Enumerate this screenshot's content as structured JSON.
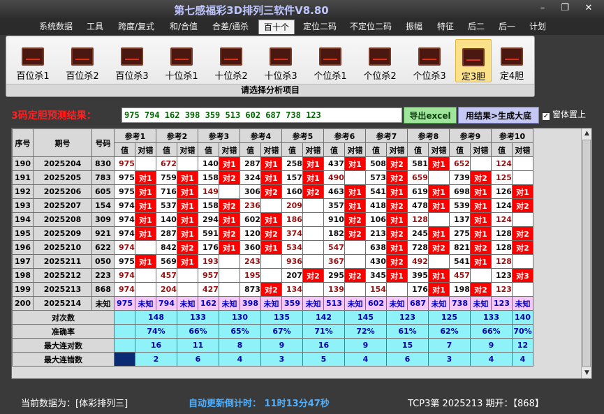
{
  "app": {
    "title": "第七感福彩3D排列三软件V8.80"
  },
  "window_buttons": [
    "–",
    "❐",
    "✕"
  ],
  "menu": [
    "系统数据",
    "工具",
    "跨度/复式",
    "和/合值",
    "合差/通杀",
    "百十个",
    "定位二码",
    "不定位二码",
    "振幅",
    "特征",
    "后二",
    "后一",
    "计划"
  ],
  "menu_active": "百十个",
  "ribbon": {
    "buttons": [
      "百位杀1",
      "百位杀2",
      "百位杀3",
      "十位杀1",
      "十位杀2",
      "十位杀3",
      "个位杀1",
      "个位杀2",
      "个位杀3",
      "定3胆",
      "定4胆"
    ],
    "selected": "定3胆",
    "group_label": "请选择分析项目"
  },
  "result": {
    "label": "3码定胆预测结果：",
    "value": "975  794  162  398  359  513  602  687  738  123",
    "export_button": "导出excel",
    "big_button": "用结果>生成大底",
    "topmost_label": "窗体置上",
    "topmost_checked": true
  },
  "table": {
    "col_seq": "序号",
    "col_period": "期号",
    "col_number": "号码",
    "ref_headers": [
      "参考1",
      "参考2",
      "参考3",
      "参考4",
      "参考5",
      "参考6",
      "参考7",
      "参考8",
      "参考9",
      "参考10"
    ],
    "sub_value": "值",
    "sub_check": "对错",
    "rows": [
      {
        "seq": "190",
        "period": "2025204",
        "number": "830",
        "cells": [
          [
            "975",
            "",
            1
          ],
          [
            "672",
            "",
            1
          ],
          [
            "140",
            "对1",
            0
          ],
          [
            "287",
            "对1",
            0
          ],
          [
            "258",
            "对1",
            0
          ],
          [
            "437",
            "对1",
            0
          ],
          [
            "508",
            "对2",
            0
          ],
          [
            "581",
            "对1",
            0
          ],
          [
            "652",
            "",
            1
          ],
          [
            "124",
            "",
            1
          ]
        ]
      },
      {
        "seq": "191",
        "period": "2025205",
        "number": "783",
        "cells": [
          [
            "975",
            "对1",
            0
          ],
          [
            "759",
            "对1",
            0
          ],
          [
            "158",
            "对2",
            0
          ],
          [
            "324",
            "对1",
            0
          ],
          [
            "157",
            "对1",
            0
          ],
          [
            "490",
            "",
            1
          ],
          [
            "573",
            "对2",
            0
          ],
          [
            "659",
            "",
            1
          ],
          [
            "739",
            "对2",
            0
          ],
          [
            "125",
            "",
            1
          ]
        ]
      },
      {
        "seq": "192",
        "period": "2025206",
        "number": "605",
        "cells": [
          [
            "975",
            "对1",
            0
          ],
          [
            "716",
            "对1",
            0
          ],
          [
            "149",
            "",
            1
          ],
          [
            "306",
            "对2",
            0
          ],
          [
            "160",
            "对2",
            0
          ],
          [
            "463",
            "对1",
            0
          ],
          [
            "541",
            "对1",
            0
          ],
          [
            "619",
            "对1",
            0
          ],
          [
            "698",
            "对1",
            0
          ],
          [
            "126",
            "对1",
            0
          ]
        ]
      },
      {
        "seq": "193",
        "period": "2025207",
        "number": "154",
        "cells": [
          [
            "974",
            "对1",
            0
          ],
          [
            "537",
            "对1",
            0
          ],
          [
            "158",
            "对2",
            0
          ],
          [
            "236",
            "",
            1
          ],
          [
            "209",
            "",
            1
          ],
          [
            "357",
            "对1",
            0
          ],
          [
            "418",
            "对2",
            0
          ],
          [
            "478",
            "对1",
            0
          ],
          [
            "539",
            "对1",
            0
          ],
          [
            "124",
            "对2",
            0
          ]
        ]
      },
      {
        "seq": "194",
        "period": "2025208",
        "number": "309",
        "cells": [
          [
            "974",
            "对1",
            0
          ],
          [
            "140",
            "对1",
            0
          ],
          [
            "294",
            "对1",
            0
          ],
          [
            "602",
            "对1",
            0
          ],
          [
            "186",
            "",
            1
          ],
          [
            "910",
            "对2",
            0
          ],
          [
            "106",
            "对1",
            0
          ],
          [
            "128",
            "",
            1
          ],
          [
            "137",
            "对1",
            0
          ],
          [
            "124",
            "",
            1
          ]
        ]
      },
      {
        "seq": "195",
        "period": "2025209",
        "number": "921",
        "cells": [
          [
            "974",
            "对1",
            0
          ],
          [
            "287",
            "对1",
            0
          ],
          [
            "591",
            "对2",
            0
          ],
          [
            "120",
            "对2",
            0
          ],
          [
            "374",
            "",
            1
          ],
          [
            "182",
            "对2",
            0
          ],
          [
            "213",
            "对2",
            0
          ],
          [
            "245",
            "对1",
            0
          ],
          [
            "275",
            "对1",
            0
          ],
          [
            "128",
            "对2",
            0
          ]
        ]
      },
      {
        "seq": "196",
        "period": "2025210",
        "number": "622",
        "cells": [
          [
            "974",
            "",
            1
          ],
          [
            "842",
            "对2",
            0
          ],
          [
            "176",
            "对1",
            0
          ],
          [
            "360",
            "对1",
            0
          ],
          [
            "534",
            "",
            1
          ],
          [
            "547",
            "",
            1
          ],
          [
            "638",
            "对1",
            0
          ],
          [
            "728",
            "对2",
            0
          ],
          [
            "821",
            "对2",
            0
          ],
          [
            "128",
            "对2",
            0
          ]
        ]
      },
      {
        "seq": "197",
        "period": "2025211",
        "number": "050",
        "cells": [
          [
            "975",
            "对1",
            0
          ],
          [
            "569",
            "对1",
            0
          ],
          [
            "193",
            "",
            1
          ],
          [
            "243",
            "",
            1
          ],
          [
            "936",
            "",
            1
          ],
          [
            "367",
            "",
            1
          ],
          [
            "430",
            "对2",
            0
          ],
          [
            "492",
            "",
            1
          ],
          [
            "541",
            "对1",
            0
          ],
          [
            "128",
            "",
            1
          ]
        ]
      },
      {
        "seq": "198",
        "period": "2025212",
        "number": "223",
        "cells": [
          [
            "974",
            "",
            1
          ],
          [
            "457",
            "",
            1
          ],
          [
            "957",
            "",
            1
          ],
          [
            "195",
            "",
            1
          ],
          [
            "207",
            "对2",
            0
          ],
          [
            "295",
            "对2",
            0
          ],
          [
            "345",
            "对1",
            0
          ],
          [
            "395",
            "对1",
            0
          ],
          [
            "457",
            "",
            1
          ],
          [
            "123",
            "对3",
            0
          ]
        ]
      },
      {
        "seq": "199",
        "period": "2025213",
        "number": "868",
        "cells": [
          [
            "974",
            "",
            1
          ],
          [
            "204",
            "",
            1
          ],
          [
            "427",
            "",
            1
          ],
          [
            "873",
            "对2",
            0
          ],
          [
            "134",
            "",
            1
          ],
          [
            "139",
            "",
            1
          ],
          [
            "154",
            "",
            1
          ],
          [
            "176",
            "对1",
            0
          ],
          [
            "198",
            "对2",
            0
          ],
          [
            "123",
            "",
            1
          ]
        ]
      }
    ],
    "predict_row": {
      "seq": "200",
      "period": "2025214",
      "number": "未知",
      "values": [
        "975",
        "794",
        "162",
        "398",
        "359",
        "513",
        "602",
        "687",
        "738",
        "123"
      ],
      "check": "未知"
    },
    "stats": [
      {
        "label": "对次数",
        "values": [
          "148",
          "133",
          "130",
          "135",
          "142",
          "145",
          "123",
          "125",
          "133",
          "140"
        ]
      },
      {
        "label": "准确率",
        "values": [
          "74%",
          "66%",
          "65%",
          "67%",
          "71%",
          "72%",
          "61%",
          "62%",
          "66%",
          "70%"
        ]
      },
      {
        "label": "最大连对数",
        "values": [
          "16",
          "11",
          "8",
          "9",
          "16",
          "9",
          "15",
          "7",
          "9",
          "12"
        ]
      },
      {
        "label": "最大连错数",
        "values": [
          "2",
          "6",
          "4",
          "3",
          "5",
          "4",
          "6",
          "3",
          "4",
          "4"
        ]
      }
    ]
  },
  "status": {
    "current_data": "当前数据为：[体彩排列三]",
    "countdown": "自动更新倒计时：  11时13分47秒",
    "period_info": "TCP3第 2025213 期开：【868】"
  },
  "colors": {
    "hit": "#ff0000",
    "predict": "#f6c8f8",
    "stats": "#8ff2f8",
    "result_text": "#006600",
    "value_red": "#9a1010"
  }
}
